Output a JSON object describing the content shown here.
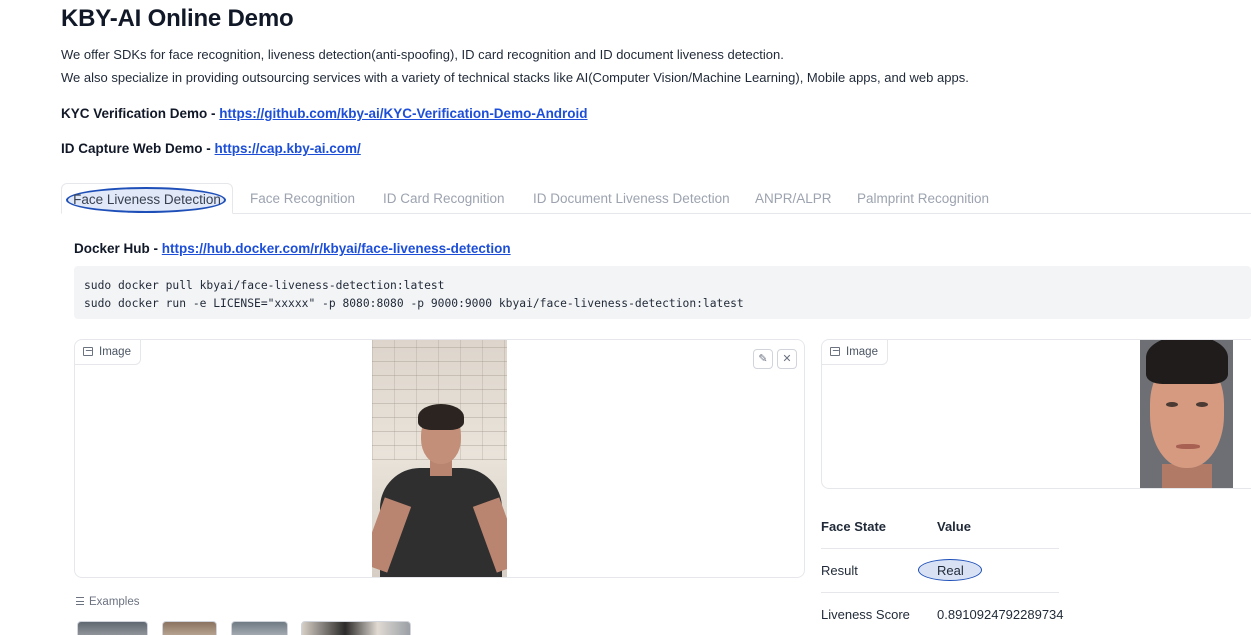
{
  "page": {
    "title": "KBY-AI Online Demo",
    "intro_line1": "We offer SDKs for face recognition, liveness detection(anti-spoofing), ID card recognition and ID document liveness detection.",
    "intro_line2": "We also specialize in providing outsourcing services with a variety of technical stacks like AI(Computer Vision/Machine Learning), Mobile apps, and web apps.",
    "kyc_label": "KYC Verification Demo - ",
    "kyc_link": "https://github.com/kby-ai/KYC-Verification-Demo-Android",
    "idcapture_label": "ID Capture Web Demo - ",
    "idcapture_link": "https://cap.kby-ai.com/"
  },
  "tabs": [
    {
      "label": "Face Liveness Detection",
      "active": true
    },
    {
      "label": "Face Recognition",
      "active": false
    },
    {
      "label": "ID Card Recognition",
      "active": false
    },
    {
      "label": "ID Document Liveness Detection",
      "active": false
    },
    {
      "label": "ANPR/ALPR",
      "active": false
    },
    {
      "label": "Palmprint Recognition",
      "active": false
    }
  ],
  "docker": {
    "label": "Docker Hub - ",
    "link": "https://hub.docker.com/r/kbyai/face-liveness-detection",
    "cmd1": "sudo docker pull kbyai/face-liveness-detection:latest",
    "cmd2": "sudo docker run -e LICENSE=\"xxxxx\" -p 8080:8080 -p 9000:9000 kbyai/face-liveness-detection:latest"
  },
  "input_panel": {
    "label": "Image",
    "icons": [
      "image-icon",
      "edit-icon",
      "close-icon"
    ]
  },
  "output_panel": {
    "label": "Image",
    "icons": [
      "image-icon"
    ]
  },
  "examples": {
    "label": "Examples",
    "icon": "list-icon",
    "count_visible": 4
  },
  "results": {
    "header": {
      "col1": "Face State",
      "col2": "Value"
    },
    "rows": [
      {
        "key": "Result",
        "value": "Real"
      },
      {
        "key": "Liveness Score",
        "value": "0.8910924792289734"
      }
    ]
  },
  "colors": {
    "link": "#1d4ed8",
    "highlight_outline": "#1e4fb8",
    "code_bg": "#f3f4f6"
  }
}
